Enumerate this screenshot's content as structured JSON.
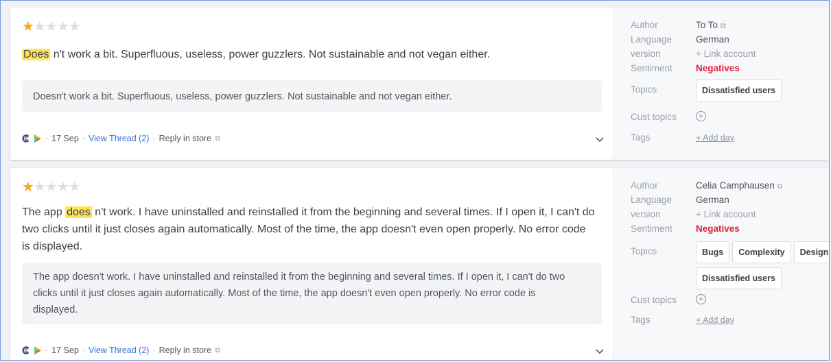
{
  "review1": {
    "stars_filled": 1,
    "stars_total": 5,
    "highlight": "Does",
    "text": " n't work a bit. Superfluous, useless, power guzzlers. Not sustainable and not vegan either.",
    "translation": "Doesn't work a bit. Superfluous, useless, power guzzlers. Not sustainable and not vegan either.",
    "date": "17 Sep",
    "thread_link": "View Thread (2)",
    "reply_link": "Reply in store",
    "meta": {
      "author_label": "Author",
      "author": "To To",
      "language_label": "Language",
      "language": "German",
      "version_label": "version",
      "version": "+ Link account",
      "sentiment_label": "Sentiment",
      "sentiment": "Negatives",
      "topics_label": "Topics",
      "topics": [
        "Dissatisfied users"
      ],
      "cust_topics_label": "Cust topics",
      "tags_label": "Tags",
      "tags_add": "+ Add day"
    }
  },
  "review2": {
    "stars_filled": 1,
    "stars_total": 5,
    "text_before": "The app ",
    "highlight": "does",
    "text_line1": " n't work. I have uninstalled and reinstalled it from the beginning and several times. If I open it, I can't do",
    "text_line2": "two clicks until it just closes again automatically. Most of the time, the app doesn't even open properly. No error code",
    "text_line3": "is displayed.",
    "translation_line1": "The app doesn't work. I have uninstalled and reinstalled it from the beginning and several times. If I open it, I can't do two",
    "translation_line2": "clicks until it just closes again automatically. Most of the time, the app doesn't even open properly. No error code is",
    "translation_line3": "displayed.",
    "date": "17 Sep",
    "thread_link": "View Thread (2)",
    "reply_link": "Reply in store",
    "meta": {
      "author_label": "Author",
      "author": "Celia Camphausen",
      "language_label": "Language",
      "language": "German",
      "version_label": "version",
      "version": "+ Link account",
      "sentiment_label": "Sentiment",
      "sentiment": "Negatives",
      "topics_label": "Topics",
      "topics": [
        "Bugs",
        "Complexity",
        "Design & UX",
        "Dissatisfied users"
      ],
      "cust_topics_label": "Cust topics",
      "tags_label": "Tags",
      "tags_add": "+ Add day"
    }
  },
  "icons": {
    "app_store": "c-logo-icon",
    "play_store": "play-triangle-icon",
    "external": "external-link-icon",
    "expand": "chevron-down-icon",
    "add_topic": "plus-circle-icon"
  },
  "colors": {
    "highlight": "#fde35a",
    "negative": "#e0233d",
    "link": "#2e6fd9",
    "star": "#f5a623"
  }
}
